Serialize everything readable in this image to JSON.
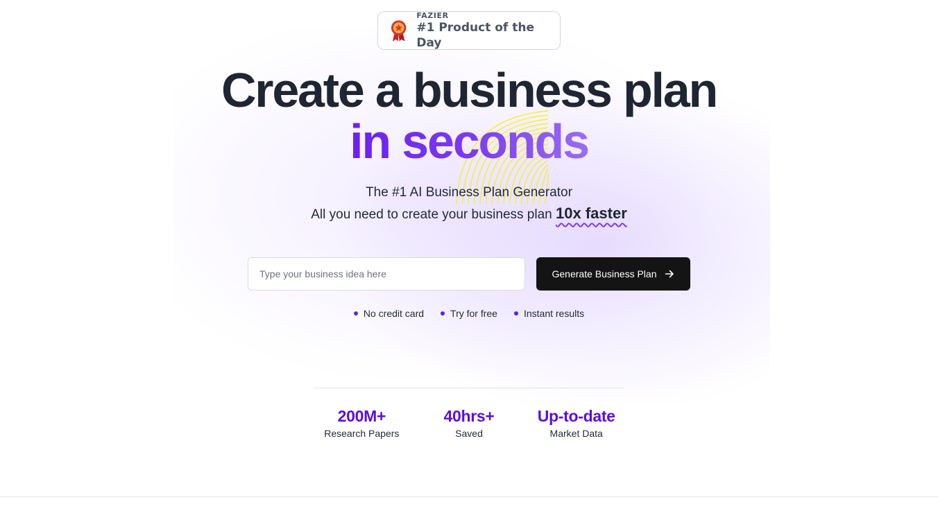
{
  "badge": {
    "kicker": "FAZIER",
    "title": "#1 Product of the Day",
    "icon": "award-medal-icon"
  },
  "hero": {
    "headline": "Create a business plan",
    "headline_accent": "in seconds",
    "subline": "The #1 AI Business Plan Generator",
    "tagline_prefix": "All you need to create your business plan ",
    "tagline_highlight": "10x faster"
  },
  "form": {
    "placeholder": "Type your business idea here",
    "value": "",
    "button_label": "Generate Business Plan",
    "button_icon": "arrow-right-icon"
  },
  "perks": [
    "No credit card",
    "Try for free",
    "Instant results"
  ],
  "stats": [
    {
      "value": "200M+",
      "label": "Research Papers"
    },
    {
      "value": "40hrs+",
      "label": "Saved"
    },
    {
      "value": "Up-to-date",
      "label": "Market Data"
    }
  ],
  "colors": {
    "accent": "#5b0fe0",
    "accent_gradient_start": "#6d1ff0",
    "accent_gradient_end": "#9a6cf2",
    "button_bg": "#141414",
    "scribble": "#f4ef1a",
    "heading": "#1e2533"
  }
}
